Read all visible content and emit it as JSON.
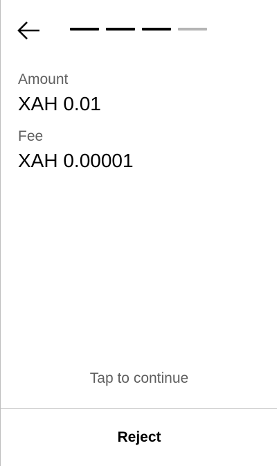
{
  "header": {
    "back_icon": "arrow-left-icon",
    "steps": [
      {
        "state": "complete"
      },
      {
        "state": "complete"
      },
      {
        "state": "complete"
      },
      {
        "state": "pending"
      }
    ]
  },
  "details": {
    "amount_label": "Amount",
    "amount_value": "XAH 0.01",
    "fee_label": "Fee",
    "fee_value": "XAH 0.00001"
  },
  "footer": {
    "tap_hint": "Tap to continue",
    "reject_label": "Reject"
  },
  "colors": {
    "text_primary": "#000000",
    "text_secondary": "#5f5f5f",
    "step_complete": "#000000",
    "step_pending": "#b5b5b5",
    "divider": "#bdbdbd"
  }
}
